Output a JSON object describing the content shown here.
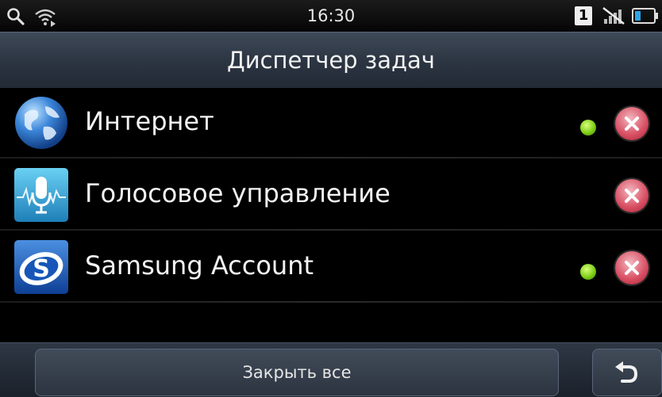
{
  "status_bar": {
    "time": "16:30",
    "sim_number": "1",
    "left_icons": [
      "search-icon",
      "wifi-icon"
    ],
    "right_icons": [
      "sim-badge",
      "muted-signal-icon",
      "battery-icon"
    ]
  },
  "header": {
    "title": "Диспетчер задач"
  },
  "apps": [
    {
      "label": "Интернет",
      "icon": "globe-icon",
      "active": true
    },
    {
      "label": "Голосовое управление",
      "icon": "voice-mic-icon",
      "active": false
    },
    {
      "label": "Samsung Account",
      "icon": "samsung-account-icon",
      "active": true
    }
  ],
  "footer": {
    "close_all_label": "Закрыть все",
    "back_icon": "back-arrow-icon"
  },
  "colors": {
    "active_dot": "#7fcf18",
    "close_button": "#d74c60",
    "header_bg": "#2b3441"
  }
}
